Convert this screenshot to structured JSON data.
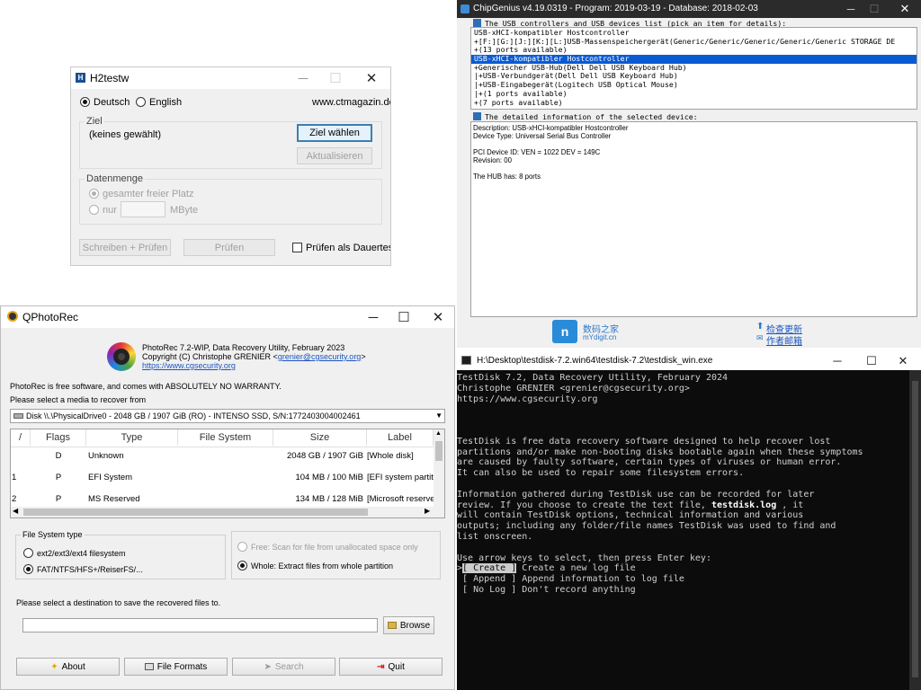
{
  "h2testw": {
    "title": "H2testw",
    "lang_de": "Deutsch",
    "lang_en": "English",
    "url": "www.ctmagazin.de",
    "ziel_label": "Ziel",
    "ziel_value": "(keines gewählt)",
    "ziel_button": "Ziel wählen",
    "refresh_button": "Aktualisieren",
    "datenmenge_label": "Datenmenge",
    "opt_all_free": "gesamter freier Platz",
    "opt_only": "nur",
    "unit_mbyte": "MByte",
    "write_verify_button": "Schreiben + Prüfen",
    "verify_button": "Prüfen",
    "endless_test_label": "Prüfen als Dauertest"
  },
  "chipgenius": {
    "title": "ChipGenius v4.19.0319 - Program: 2019-03-19 - Database: 2018-02-03",
    "list_header": "The USB controllers and USB devices list (pick an item for details):",
    "list_items": [
      "USB-xHCI-kompatibler Hostcontroller",
      "+[F:][G:][J:][K:][L:]USB-Massenspeichergerät(Generic/Generic/Generic/Generic/Generic STORAGE DE",
      "+(13 ports available)",
      "USB-xHCI-kompatibler Hostcontroller",
      "+Generischer USB-Hub(Dell Dell USB Keyboard Hub)",
      "|+USB-Verbundgerät(Dell Dell USB Keyboard Hub)",
      "|+USB-Eingabegerät(Logitech USB Optical Mouse)",
      "|+(1 ports available)",
      "+(7 ports available)"
    ],
    "selected_index": 3,
    "detail_header": "The detailed information of the selected device:",
    "detail_lines": [
      "Description: USB-xHCI-kompatibler Hostcontroller",
      "Device Type: Universal Serial Bus Controller",
      "",
      "PCI Device ID: VEN = 1022 DEV = 149C",
      "Revision: 00",
      "",
      "The HUB has: 8 ports"
    ],
    "logo_cn": "数码之家",
    "logo_url": "mYdigit.cn",
    "check_update": "检查更新",
    "author_mail": "作者邮箱"
  },
  "qphotorec": {
    "title": "QPhotoRec",
    "app_name": "PhotoRec 7.2-WIP, Data Recovery Utility, February 2023",
    "copyright": "Copyright (C) Christophe GRENIER <",
    "email": "grenier@cgsecurity.org",
    "copyright_end": ">",
    "website": "https://www.cgsecurity.org",
    "free_notice": "PhotoRec is free software, and comes with ABSOLUTELY NO WARRANTY.",
    "select_media": "Please select a media to recover from",
    "disk": "Disk \\\\.\\PhysicalDrive0 - 2048 GB / 1907 GiB (RO) - INTENSO SSD, S/N:1772403004002461",
    "columns": [
      "/",
      "Flags",
      "Type",
      "File System",
      "Size",
      "Label"
    ],
    "rows": [
      {
        "num": "",
        "flags": "D",
        "type": "Unknown",
        "fs": "",
        "size": "2048 GB / 1907 GiB",
        "label": "[Whole disk]"
      },
      {
        "num": "1",
        "flags": "P",
        "type": "EFI System",
        "fs": "",
        "size": "104 MB / 100 MiB",
        "label": "[EFI system partition]"
      },
      {
        "num": "2",
        "flags": "P",
        "type": "MS Reserved",
        "fs": "",
        "size": "134 MB / 128 MiB",
        "label": "[Microsoft reserved partition"
      }
    ],
    "fs_type_label": "File System type",
    "fs_ext": "ext2/ext3/ext4 filesystem",
    "fs_fat": "FAT/NTFS/HFS+/ReiserFS/...",
    "mode_free": "Free: Scan for file from unallocated space only",
    "mode_whole": "Whole: Extract files from whole partition",
    "dest_label": "Please select a destination to save the recovered files to.",
    "dest_value": "",
    "browse_button": "Browse",
    "about_button": "About",
    "formats_button": "File Formats",
    "search_button": "Search",
    "quit_button": "Quit"
  },
  "testdisk": {
    "title": "H:\\Desktop\\testdisk-7.2.win64\\testdisk-7.2\\testdisk_win.exe",
    "header": [
      "TestDisk 7.2, Data Recovery Utility, February 2024",
      "Christophe GRENIER <grenier@cgsecurity.org>",
      "https://www.cgsecurity.org"
    ],
    "para1": [
      "TestDisk is free data recovery software designed to help recover lost",
      "partitions and/or make non-booting disks bootable again when these symptoms",
      "are caused by faulty software, certain types of viruses or human error.",
      "It can also be used to repair some filesystem errors."
    ],
    "para2_a": "Information gathered during TestDisk use can be recorded for later",
    "para2_b_pre": "review. If you choose to create the text file, ",
    "para2_b_bold": "testdisk.log",
    "para2_b_post": " , it",
    "para2_rest": [
      "will contain TestDisk options, technical information and various",
      "outputs; including any folder/file names TestDisk was used to find and",
      "list onscreen."
    ],
    "prompt": "Use arrow keys to select, then press Enter key:",
    "menu": [
      {
        "marker": ">",
        "option": "[ Create ]",
        "desc": " Create a new log file"
      },
      {
        "marker": " ",
        "option": "[ Append ]",
        "desc": " Append information to log file"
      },
      {
        "marker": " ",
        "option": "[ No Log ]",
        "desc": " Don't record anything"
      }
    ],
    "selected_menu": 0
  }
}
